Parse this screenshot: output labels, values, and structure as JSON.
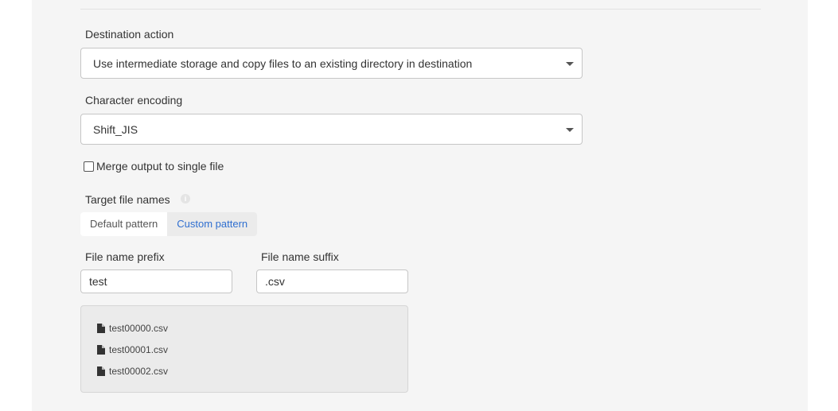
{
  "destination_action": {
    "label": "Destination action",
    "selected": "Use intermediate storage and copy files to an existing directory in destination"
  },
  "character_encoding": {
    "label": "Character encoding",
    "selected": "Shift_JIS"
  },
  "merge_output": {
    "label": "Merge output to single file",
    "checked": false
  },
  "target_file_names": {
    "label": "Target file names",
    "info_icon": "info-icon",
    "options": [
      "Default pattern",
      "Custom pattern"
    ],
    "active": "Custom pattern"
  },
  "file_name_prefix": {
    "label": "File name prefix",
    "value": "test"
  },
  "file_name_suffix": {
    "label": "File name suffix",
    "value": ".csv"
  },
  "preview": {
    "files": [
      "test00000.csv",
      "test00001.csv",
      "test00002.csv"
    ]
  },
  "colors": {
    "active_tab": "#2f6fd0",
    "panel_background": "#f5f5f5"
  }
}
